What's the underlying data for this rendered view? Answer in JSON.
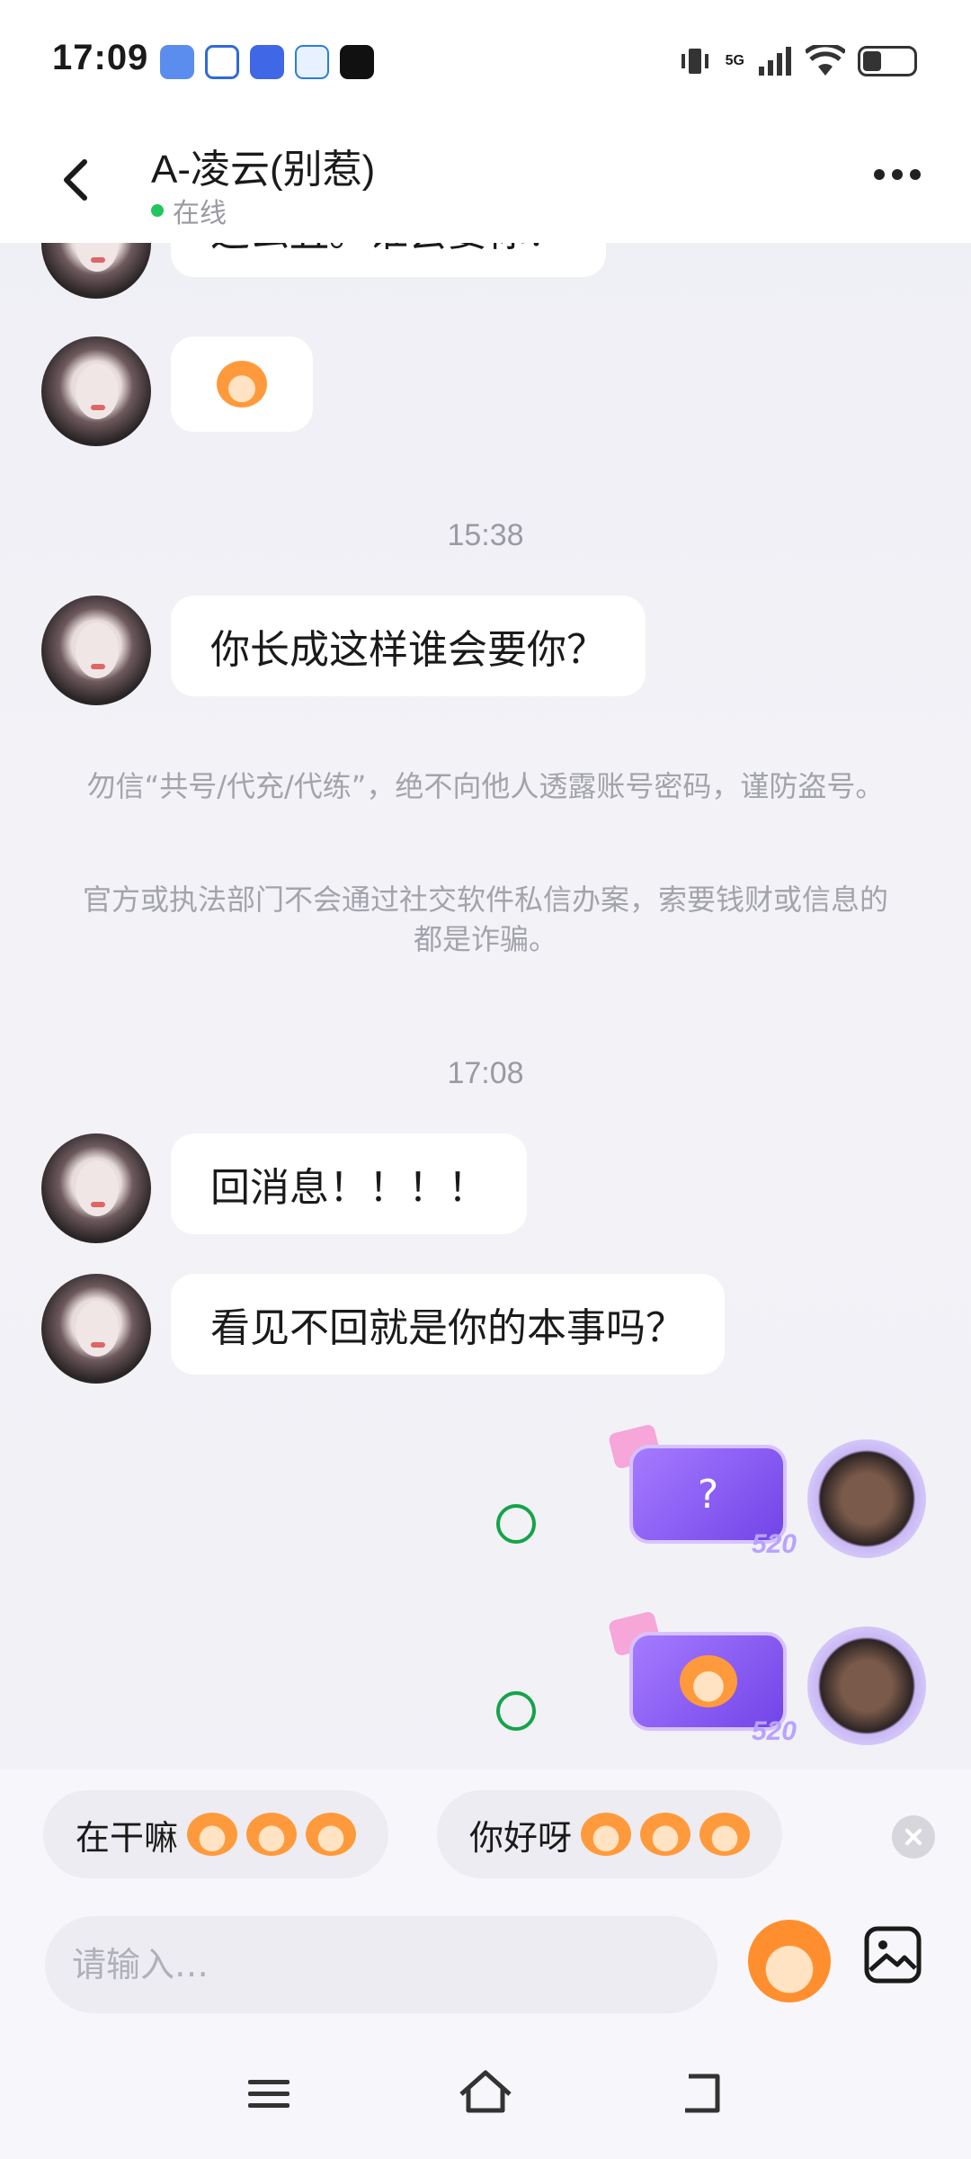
{
  "status_bar": {
    "time": "17:09",
    "network": "5G"
  },
  "header": {
    "title": "A-凌云(别惹)",
    "status": "在线"
  },
  "messages": [
    {
      "type": "text",
      "from": "other",
      "text": "这么丑。谁会要你？"
    },
    {
      "type": "sticker",
      "from": "other"
    },
    {
      "type": "timestamp",
      "text": "15:38"
    },
    {
      "type": "text",
      "from": "other",
      "text": "你长成这样谁会要你？"
    },
    {
      "type": "notice",
      "text": "勿信“共号/代充/代练”，绝不向他人透露账号密码，谨防盗号。"
    },
    {
      "type": "notice",
      "text": "官方或执法部门不会通过社交软件私信办案，索要钱财或信息的都是诈骗。"
    },
    {
      "type": "timestamp",
      "text": "17:08"
    },
    {
      "type": "text",
      "from": "other",
      "text": "回消息！！！！"
    },
    {
      "type": "text",
      "from": "other",
      "text": "看见不回就是你的本事吗？"
    },
    {
      "type": "sticker",
      "from": "self",
      "text": "?",
      "badge": "520",
      "status": "delivered"
    },
    {
      "type": "sticker",
      "from": "self",
      "badge": "520",
      "status": "delivered"
    }
  ],
  "quick_replies": [
    {
      "label": "在干嘛",
      "emoji_count": 3
    },
    {
      "label": "你好呀",
      "emoji_count": 3
    }
  ],
  "input": {
    "placeholder": "请输入…"
  },
  "colors": {
    "online": "#22c55e",
    "check": "#16a34a",
    "sticker_purple": "#7244e8"
  }
}
